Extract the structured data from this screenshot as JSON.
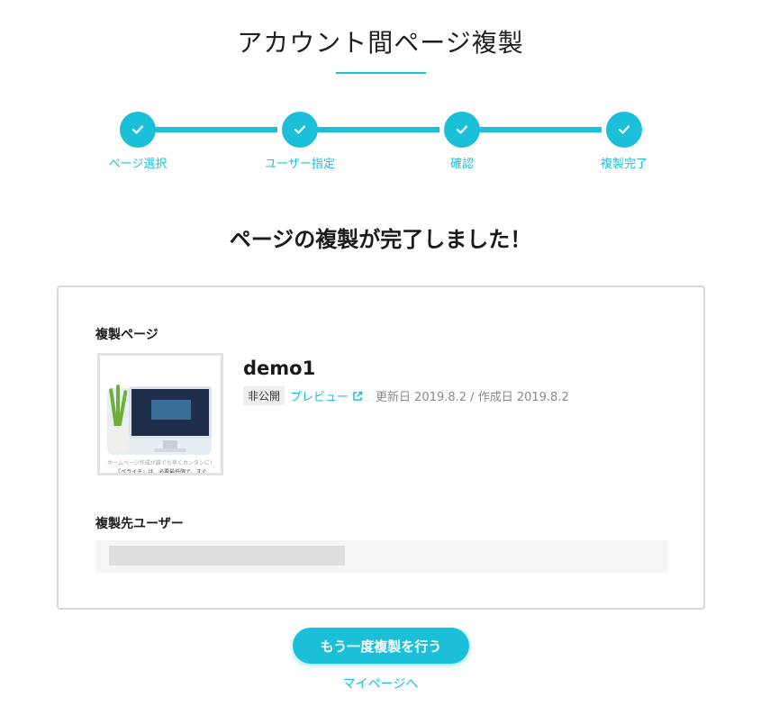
{
  "header": {
    "title": "アカウント間ページ複製"
  },
  "stepper": {
    "steps": [
      {
        "label": "ページ選択",
        "state": "done"
      },
      {
        "label": "ユーザー指定",
        "state": "done"
      },
      {
        "label": "確認",
        "state": "done"
      },
      {
        "label": "複製完了",
        "state": "done"
      }
    ]
  },
  "result": {
    "heading": "ページの複製が完了しました！"
  },
  "card": {
    "page_section_label": "複製ページ",
    "page": {
      "name": "demo1",
      "status": "非公開",
      "preview_label": "プレビュー",
      "dates": "更新日 2019.8.2 / 作成日 2019.8.2",
      "thumbnail_caption": "ホームページ作成が誰でも早くカンタンに！",
      "thumbnail_caption2": "『ペライチ』は、必要最低限で、すぐ"
    },
    "user_section_label": "複製先ユーザー",
    "user_value": ""
  },
  "actions": {
    "again_label": "もう一度複製を行う",
    "mypage_label": "マイページへ"
  },
  "colors": {
    "accent": "#1bbfd8"
  }
}
